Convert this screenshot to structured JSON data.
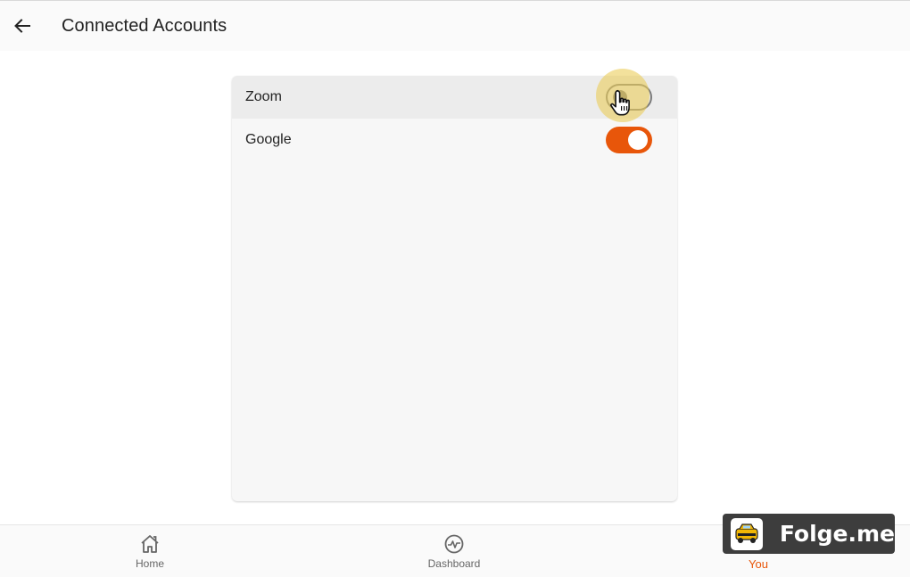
{
  "header": {
    "title": "Connected Accounts",
    "back_icon": "arrow-left-icon"
  },
  "accounts": [
    {
      "label": "Zoom",
      "enabled": false
    },
    {
      "label": "Google",
      "enabled": true
    }
  ],
  "bottom_nav": {
    "items": [
      {
        "label": "Home",
        "icon": "home-icon",
        "selected": false
      },
      {
        "label": "Dashboard",
        "icon": "dashboard-icon",
        "selected": false
      },
      {
        "label": "You",
        "icon": "person-icon",
        "selected": true
      }
    ]
  },
  "watermark": {
    "text": "Folge.me"
  },
  "colors": {
    "accent": "#e8560a",
    "toggle_off": "#7a7a7a",
    "card_bg": "#f7f7f7"
  }
}
